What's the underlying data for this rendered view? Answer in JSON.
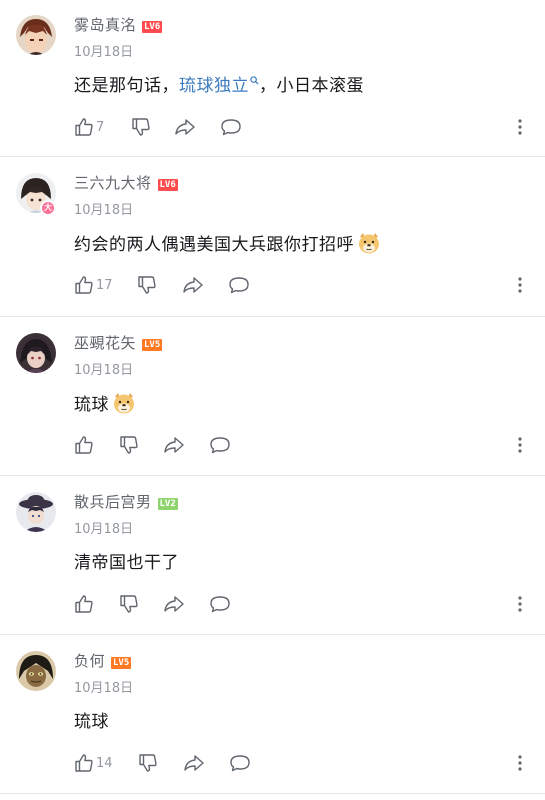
{
  "comments": [
    {
      "username": "雾岛真洺",
      "level": "LV6",
      "date": "10月18日",
      "content_before": "还是那句话，",
      "content_link": "琉球独立",
      "content_after": "，小日本滚蛋",
      "likes": "7",
      "avatar": "anime-boy-brown-hair"
    },
    {
      "username": "三六九大将",
      "level": "LV6",
      "date": "10月18日",
      "content": "约会的两人偶遇美国大兵跟你打招呼",
      "emoji": "doge-emoji",
      "likes": "17",
      "vip_badge": "大",
      "avatar": "anime-girl-dark-hair"
    },
    {
      "username": "巫覡花矢",
      "level": "LV5",
      "date": "10月18日",
      "content": "琉球",
      "emoji": "doge-emoji",
      "likes": "",
      "avatar": "dark-anime-character"
    },
    {
      "username": "散兵后宫男",
      "level": "LV2",
      "date": "10月18日",
      "content": "清帝国也干了",
      "likes": "",
      "avatar": "wanderer-hat-character"
    },
    {
      "username": "负何",
      "level": "LV5",
      "date": "10月18日",
      "content": "琉球",
      "likes": "14",
      "avatar": "dark-skin-character"
    }
  ],
  "colors": {
    "lv6": "#ff4d4f",
    "lv5": "#ff7a22",
    "lv2": "#8fd46d",
    "link": "#3a7bbf",
    "meta": "#9499a0"
  }
}
